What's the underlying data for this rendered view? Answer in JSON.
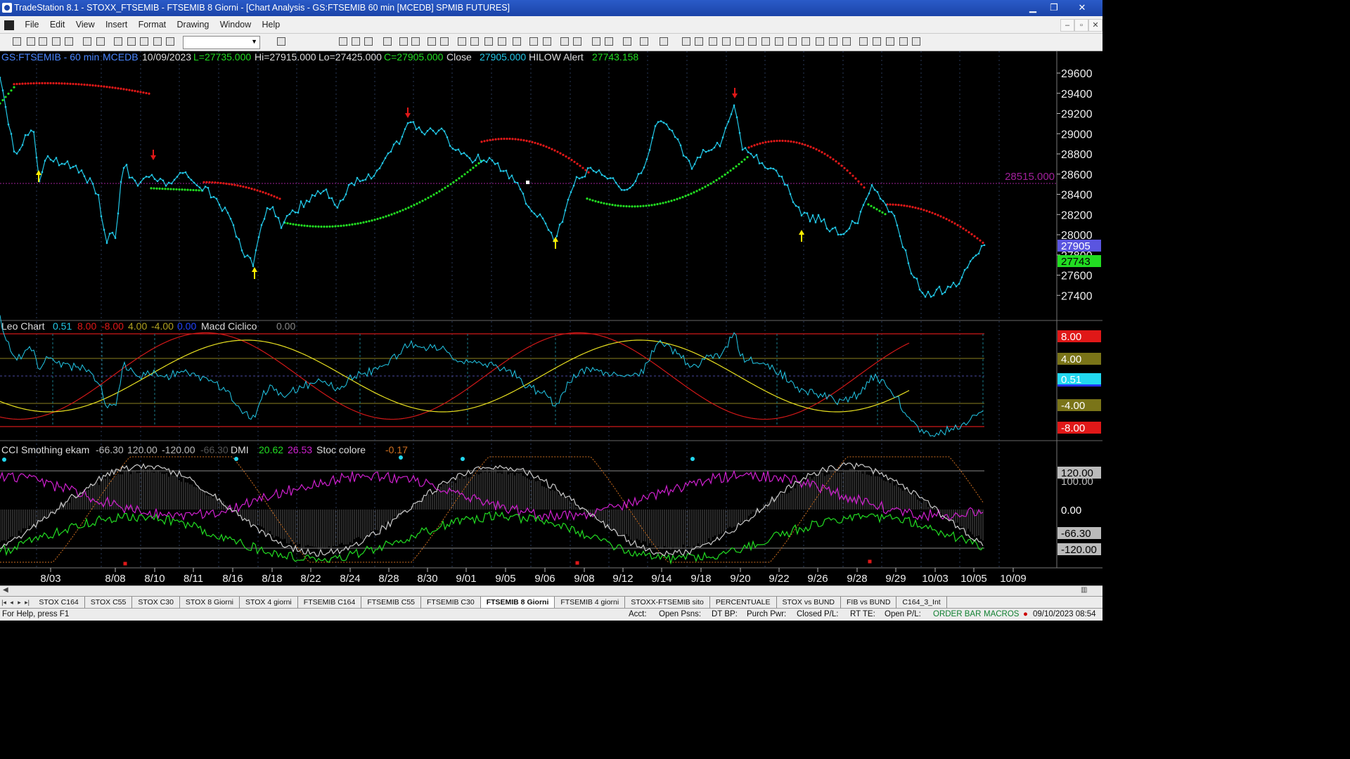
{
  "window": {
    "title": "TradeStation 8.1 - STOXX_FTSEMIB - FTSEMIB  8 Giorni - [Chart Analysis - GS:FTSEMIB  60 min  [MCEDB] SPMIB FUTURES]",
    "min": "▁",
    "max": "❐",
    "close": "✕"
  },
  "menu": [
    "File",
    "Edit",
    "View",
    "Insert",
    "Format",
    "Drawing",
    "Window",
    "Help"
  ],
  "mdi_buttons": [
    "–",
    "▫",
    "✕"
  ],
  "chart": {
    "header": {
      "symbol": "GS:FTSEMIB - 60 min",
      "feed": "MCEDB",
      "date": "10/09/2023",
      "last": "L=27735.000",
      "high": "Hi=27915.000",
      "low": "Lo=27425.000",
      "close_val": "C=27905.000",
      "close_lbl": "Close",
      "close_num": "27905.000",
      "alert_lbl": "HILOW Alert",
      "alert_num": "27743.158"
    },
    "price_axis": [
      "29600",
      "29400",
      "29200",
      "29000",
      "28800",
      "28600",
      "28400",
      "28200",
      "28000",
      "27800",
      "27600",
      "27400"
    ],
    "price_level_label": "28515.000",
    "price_flag_close": "27905",
    "price_flag_alert": "27743",
    "leo": {
      "title": "Leo Chart",
      "v1": "0.51",
      "v2": "8.00",
      "v3": "-8.00",
      "v4": "4.00",
      "v5": "-4.00",
      "v6": "0.00",
      "macd": "Macd Ciclico",
      "macd_v": "0.00",
      "flags": [
        "8.00",
        "4.00",
        "0.51",
        "-4.00",
        "-8.00"
      ]
    },
    "cci": {
      "title": "CCI Smothing ekam",
      "v1": "-66.30",
      "v2": "120.00",
      "v3": "-120.00",
      "v4": "-66.30",
      "dmi": "DMI",
      "dmi_v1": "20.62",
      "dmi_v2": "26.53",
      "stoc": "Stoc colore",
      "stoc_v": "-0.17",
      "flags": [
        "120.00",
        "100.00",
        "0.00",
        "-66.30",
        "-120.00"
      ]
    },
    "dates": [
      "8/03",
      "8/08",
      "8/10",
      "8/11",
      "8/16",
      "8/18",
      "8/22",
      "8/24",
      "8/28",
      "8/30",
      "9/01",
      "9/05",
      "9/06",
      "9/08",
      "9/12",
      "9/14",
      "9/18",
      "9/20",
      "9/22",
      "9/26",
      "9/28",
      "9/29",
      "10/03",
      "10/05",
      "10/09"
    ]
  },
  "chart_data": {
    "type": "line",
    "series": [],
    "ylim": [
      27300,
      29700
    ],
    "x": [
      "8/03",
      "8/08",
      "8/10",
      "8/11",
      "8/16",
      "8/18",
      "8/22",
      "8/24",
      "8/28",
      "8/30",
      "9/01",
      "9/05",
      "9/06",
      "9/08",
      "9/12",
      "9/14",
      "9/18",
      "9/20",
      "9/22",
      "9/26",
      "9/28",
      "9/29",
      "10/03",
      "10/05"
    ],
    "y": [
      28860,
      28000,
      28670,
      28420,
      27730,
      28280,
      28330,
      28500,
      28810,
      28960,
      28840,
      28680,
      28190,
      28580,
      28450,
      29100,
      28900,
      29240,
      28540,
      28200,
      28480,
      27980,
      27400,
      27905
    ]
  },
  "tabs": [
    "STOX C164",
    "STOX C55",
    "STOX  C30",
    "STOX  8 Giorni",
    "STOX 4 giorni",
    "FTSEMIB C164",
    "FTSEMIB C55",
    "FTSEMIB C30",
    "FTSEMIB  8 Giorni",
    "FTSEMIB  4 giorni",
    "STOXX-FTSEMIB sito",
    "PERCENTUALE",
    "STOX vs BUND",
    "FIB vs BUND",
    "C164_3_Int"
  ],
  "active_tab": "FTSEMIB  8 Giorni",
  "status": {
    "help": "For Help, press F1",
    "acct": "Acct:",
    "open_psns": "Open Psns:",
    "dt_bp": "DT BP:",
    "purch": "Purch Pwr:",
    "closed": "Closed P/L:",
    "rt_te": "RT TE:",
    "open_pl": "Open P/L:",
    "order_bar": "ORDER BAR",
    "macros": "MACROS",
    "datetime": "09/10/2023 08:54"
  },
  "colors": {
    "price": "#22c8e8",
    "stop_up": "#22dd22",
    "stop_dn": "#e01818",
    "yellow": "#e8e020",
    "magenta": "#d020d0",
    "leo_red": "#d01818"
  }
}
